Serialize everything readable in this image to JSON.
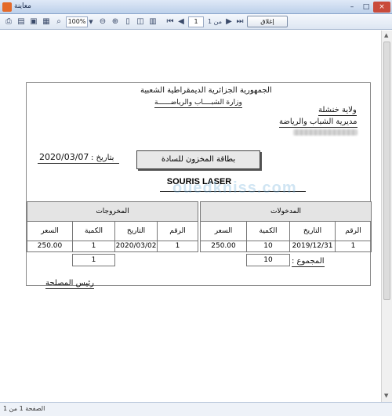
{
  "window": {
    "title": "معاينة",
    "min": "–",
    "max": "□",
    "close": "×"
  },
  "toolbar": {
    "zoom": "100%",
    "page_current": "1",
    "page_of": "من 1",
    "close_label": "إغلاق"
  },
  "report": {
    "republic": "الجمهورية الجزائرية الديمقراطية الشعبية",
    "ministry": "وزارة الشبــــاب والرياضــــــة",
    "wilaya": "ولاية خنشلة",
    "directorate": "مديرية الشباب والرياضة",
    "date_label": "بتاريخ :",
    "date_value": "2020/03/07",
    "card_title": "بطاقة المخزون للسادة",
    "product": "SOURIS LASER",
    "in_section": {
      "title": "المدخولات",
      "headers": [
        "الرقم",
        "التاريخ",
        "الكمية",
        "السعر"
      ],
      "row": {
        "num": "1",
        "date": "2019/12/31",
        "qty": "10",
        "price": "250.00"
      },
      "total_qty": "10"
    },
    "out_section": {
      "title": "المخروجات",
      "headers": [
        "الرقم",
        "التاريخ",
        "الكمية",
        "السعر"
      ],
      "row": {
        "num": "1",
        "date": "2020/03/02",
        "qty": "1",
        "price": "250.00"
      },
      "total_qty": "1"
    },
    "total_label": "المجموع :",
    "signature": "رئيس المصلحة"
  },
  "watermark": "ouedkniss.com",
  "status": {
    "text": "الصفحة 1 من 1"
  }
}
